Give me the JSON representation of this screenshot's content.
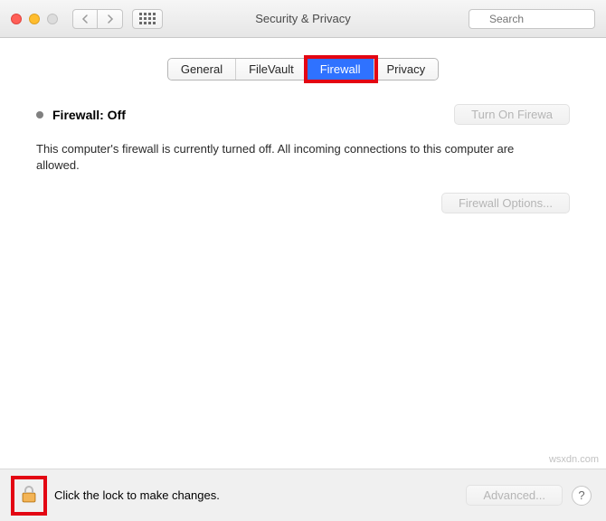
{
  "window": {
    "title": "Security & Privacy"
  },
  "search": {
    "placeholder": "Search"
  },
  "tabs": [
    {
      "label": "General"
    },
    {
      "label": "FileVault"
    },
    {
      "label": "Firewall",
      "active": true,
      "highlighted": true
    },
    {
      "label": "Privacy"
    }
  ],
  "firewall": {
    "status_label": "Firewall: Off",
    "turn_on_label": "Turn On Firewa",
    "description": "This computer's firewall is currently turned off. All incoming connections to this computer are allowed.",
    "options_label": "Firewall Options..."
  },
  "footer": {
    "lock_text": "Click the lock to make changes.",
    "advanced_label": "Advanced...",
    "help_label": "?"
  },
  "watermark": "wsxdn.com"
}
